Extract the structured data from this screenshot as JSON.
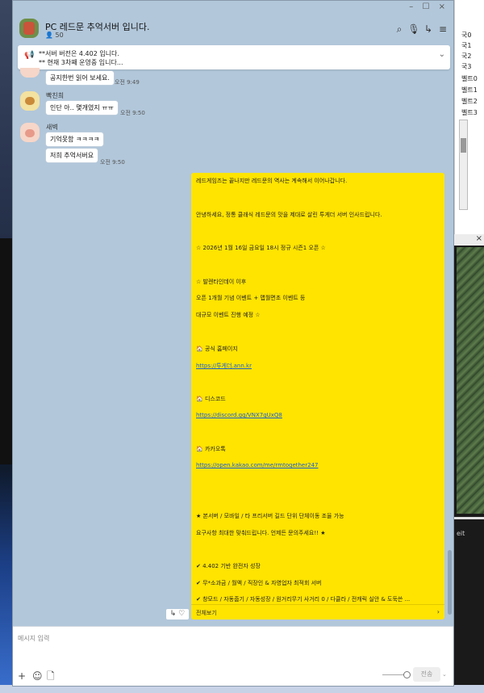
{
  "background": {
    "right_panel_items": [
      "국0",
      "국1",
      "국2",
      "국3",
      "벨트0",
      "벨트1",
      "벨트2",
      "벨트3"
    ],
    "dark_window_close": "×",
    "edge_text": "eit"
  },
  "window": {
    "controls": "– ☐ ×",
    "room_title": "PC 레드문 추억서버 입니다.",
    "member_count": "50",
    "header_icons": [
      "search-icon",
      "mic-icon",
      "call-icon",
      "menu-icon"
    ]
  },
  "notice": {
    "line1": "**서버 버전은 4.402 입니다.",
    "line2": "** 현재 3차째 운영중 입니다...",
    "chevron": "⌄"
  },
  "messages": [
    {
      "sender": "",
      "text": "공지한번 읽어 보세요.",
      "time": "오전 9:49"
    },
    {
      "sender": "빡친희",
      "text": "인단 아.. 몇개였지 ㅠㅠ",
      "time": "오전 9:50"
    },
    {
      "sender": "새벽",
      "text": "기억못함 ㅋㅋㅋㅋ",
      "time": ""
    },
    {
      "sender": "",
      "text": "저희 추억서버요",
      "time": "오전 9:50"
    }
  ],
  "announcement": {
    "lines": [
      {
        "text": "레드게임즈는 끝나지만 레드문의 역사는 계속해서 이어나갑니다.",
        "link": false
      },
      {
        "text": "안녕하세요, 정통 클래식 레드문의 맛을 제대로 살린 투게더 서버 인사드립니다.",
        "link": false
      },
      {
        "text": "☆ 2026년 1월 16일 금요일 18시 정규 시즌1 오픈 ☆",
        "link": false
      },
      {
        "text": "☆ 발렌타인데이 이후",
        "link": false
      },
      {
        "text": "오픈 1개월 기념 이벤트 + 맵월면초 이벤트 등",
        "link": false
      },
      {
        "text": "대규모 이벤트 진행 예정 ☆",
        "link": false
      },
      {
        "text": "🏠 공식 홈페이지",
        "link": false
      },
      {
        "text": "https://투게더.ann.kr",
        "link": true
      },
      {
        "text": "🏠 디스코드",
        "link": false
      },
      {
        "text": "https://discord.gg/VNX7gUxQ8",
        "link": true
      },
      {
        "text": "🏠 카카오톡",
        "link": false
      },
      {
        "text": "https://open.kakao.com/me/rmtogether247",
        "link": true
      },
      {
        "text": "★ 본서버 / 모바일 / 타 프리서버 길드 단위 단체이동 조율 가능",
        "link": false
      },
      {
        "text": "요구사항 최대한 맞춰드립니다. 언제든 문의주세요!! ★",
        "link": false
      },
      {
        "text": "✔ 4.402 기반 완전자 성장",
        "link": false
      },
      {
        "text": "✔ 무*소과금 / 월액 / 직장인 & 자영업자 최적회 서버",
        "link": false
      },
      {
        "text": "✔ 창모드 / 자동줍기 / 자동성장 / 원거리무기 사거리 0 / 다클라 / 전캐릭 실안 & 도둑쓴 ...",
        "link": false
      }
    ],
    "see_more": "전체보기",
    "see_more_arrow": "›"
  },
  "reactions": "↳ ♡",
  "input": {
    "placeholder": "메시지 입력",
    "send_label": "전송",
    "send_options": "⌄",
    "tool_icons": [
      "plus-icon",
      "emoji-icon",
      "file-icon"
    ]
  }
}
